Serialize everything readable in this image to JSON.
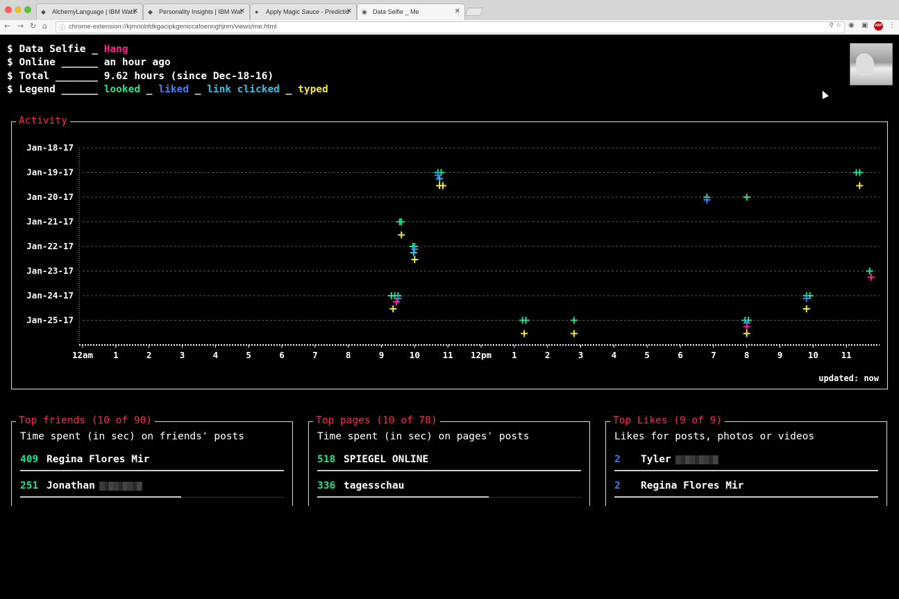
{
  "browser": {
    "tabs": [
      {
        "title": "AlchemyLanguage | IBM Wats",
        "active": false
      },
      {
        "title": "Personality Insights | IBM Wat",
        "active": false
      },
      {
        "title": "Apply Magic Sauce - Predictio",
        "active": false
      },
      {
        "title": "Data Selfie _ Me",
        "active": true
      }
    ],
    "url": "chrome-extension://kjmnobfdkgacipkgenicca​foennghjnm/views/me.html"
  },
  "header": {
    "title_prefix": "$ Data Selfie _ ",
    "user_name": "Hang",
    "online_label": "$ Online ______ ",
    "online_value": "an hour ago",
    "total_label": "$ Total _______ ",
    "total_value": "9.62 hours (since Dec-18-16)",
    "legend_label": "$ Legend ______ ",
    "legend_looked": "looked",
    "legend_sep1": " _ ",
    "legend_liked": "liked",
    "legend_sep2": " _ ",
    "legend_link": "link clicked",
    "legend_sep3": " _ ",
    "legend_typed": "typed"
  },
  "colors": {
    "looked": "#1fe58a",
    "liked": "#3a82f7",
    "link_clicked": "#29c8ea",
    "typed": "#f4ea3c",
    "accent": "#ff2a4c",
    "extra": "#ff1f8e"
  },
  "activity": {
    "title": "Activity",
    "updated": "updated: now"
  },
  "chart_data": {
    "type": "scatter",
    "title": "Activity",
    "dates": [
      "Jan-18-17",
      "Jan-19-17",
      "Jan-20-17",
      "Jan-21-17",
      "Jan-22-17",
      "Jan-23-17",
      "Jan-24-17",
      "Jan-25-17"
    ],
    "hour_ticks": [
      "12am",
      "1",
      "2",
      "3",
      "4",
      "5",
      "6",
      "7",
      "8",
      "9",
      "10",
      "11",
      "12pm",
      "1",
      "2",
      "3",
      "4",
      "5",
      "6",
      "7",
      "8",
      "9",
      "10",
      "11"
    ],
    "x_range_hours": [
      0,
      24
    ],
    "grid": true,
    "series": [
      {
        "name": "looked",
        "points": [
          [
            10.7,
            "Jan-19-17"
          ],
          [
            10.8,
            "Jan-19-17"
          ],
          [
            23.3,
            "Jan-19-17"
          ],
          [
            23.4,
            "Jan-19-17"
          ],
          [
            18.8,
            "Jan-20-17"
          ],
          [
            20.0,
            "Jan-20-17"
          ],
          [
            9.55,
            "Jan-21-17"
          ],
          [
            9.6,
            "Jan-21-17"
          ],
          [
            9.95,
            "Jan-22-17"
          ],
          [
            10.0,
            "Jan-22-17"
          ],
          [
            23.7,
            "Jan-23-17"
          ],
          [
            9.3,
            "Jan-24-17"
          ],
          [
            9.4,
            "Jan-24-17"
          ],
          [
            9.5,
            "Jan-24-17"
          ],
          [
            21.8,
            "Jan-24-17"
          ],
          [
            21.9,
            "Jan-24-17"
          ],
          [
            13.25,
            "Jan-25-17"
          ],
          [
            13.35,
            "Jan-25-17"
          ],
          [
            14.8,
            "Jan-25-17"
          ],
          [
            19.95,
            "Jan-25-17"
          ],
          [
            20.05,
            "Jan-25-17"
          ]
        ]
      },
      {
        "name": "liked",
        "points": [
          [
            10.7,
            "Jan-19-17"
          ],
          [
            18.8,
            "Jan-20-17"
          ],
          [
            10.0,
            "Jan-22-17"
          ],
          [
            9.5,
            "Jan-24-17"
          ],
          [
            21.8,
            "Jan-24-17"
          ],
          [
            20.0,
            "Jan-25-17"
          ]
        ]
      },
      {
        "name": "link clicked",
        "points": [
          [
            10.75,
            "Jan-19-17"
          ],
          [
            9.97,
            "Jan-22-17"
          ],
          [
            9.45,
            "Jan-24-17"
          ]
        ]
      },
      {
        "name": "typed",
        "points": [
          [
            10.75,
            "Jan-19-17"
          ],
          [
            10.85,
            "Jan-19-17"
          ],
          [
            23.4,
            "Jan-19-17"
          ],
          [
            9.6,
            "Jan-21-17"
          ],
          [
            10.0,
            "Jan-22-17"
          ],
          [
            9.35,
            "Jan-24-17"
          ],
          [
            21.8,
            "Jan-24-17"
          ],
          [
            13.3,
            "Jan-25-17"
          ],
          [
            14.8,
            "Jan-25-17"
          ],
          [
            20.0,
            "Jan-25-17"
          ]
        ]
      },
      {
        "name": "other",
        "points": [
          [
            23.75,
            "Jan-23-17"
          ],
          [
            9.45,
            "Jan-24-17"
          ],
          [
            20.0,
            "Jan-25-17"
          ]
        ]
      }
    ]
  },
  "top_friends": {
    "title": "Top friends (10 of 90)",
    "subtitle": "Time spent (in sec) on friends' posts",
    "rows": [
      {
        "value": "409",
        "name": "Regina Flores Mir",
        "fraction": 1.0
      },
      {
        "value": "251",
        "name": "Jonathan",
        "fraction": 0.61
      }
    ]
  },
  "top_pages": {
    "title": "Top pages (10 of 78)",
    "subtitle": "Time spent (in sec) on pages' posts",
    "rows": [
      {
        "value": "518",
        "name": "SPIEGEL ONLINE",
        "fraction": 1.0
      },
      {
        "value": "336",
        "name": "tagesschau",
        "fraction": 0.65
      }
    ]
  },
  "top_likes": {
    "title": "Top Likes (9 of 9)",
    "subtitle": "Likes for posts, photos or videos",
    "rows": [
      {
        "value": "2",
        "name": "Tyler",
        "fraction": 1.0
      },
      {
        "value": "2",
        "name": "Regina Flores Mir",
        "fraction": 1.0
      }
    ]
  }
}
